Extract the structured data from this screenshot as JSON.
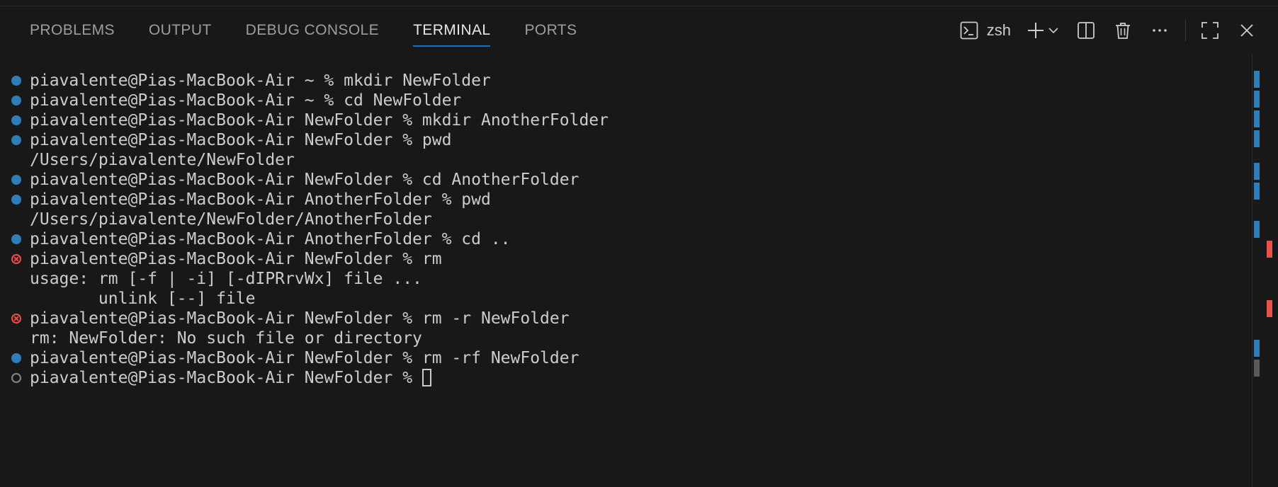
{
  "tabs": [
    {
      "label": "PROBLEMS",
      "active": false
    },
    {
      "label": "OUTPUT",
      "active": false
    },
    {
      "label": "DEBUG CONSOLE",
      "active": false
    },
    {
      "label": "TERMINAL",
      "active": true
    },
    {
      "label": "PORTS",
      "active": false
    }
  ],
  "toolbar": {
    "shell_label": "zsh",
    "icons": [
      "terminal-icon",
      "plus-icon",
      "chevron-down-icon",
      "split-icon",
      "trash-icon",
      "more-icon",
      "maximize-icon",
      "close-icon"
    ]
  },
  "terminal": {
    "lines": [
      {
        "status": "success",
        "text": "piavalente@Pias-MacBook-Air ~ % mkdir NewFolder"
      },
      {
        "status": "success",
        "text": "piavalente@Pias-MacBook-Air ~ % cd NewFolder"
      },
      {
        "status": "success",
        "text": "piavalente@Pias-MacBook-Air NewFolder % mkdir AnotherFolder"
      },
      {
        "status": "success",
        "text": "piavalente@Pias-MacBook-Air NewFolder % pwd"
      },
      {
        "status": "none",
        "text": "/Users/piavalente/NewFolder"
      },
      {
        "status": "success",
        "text": "piavalente@Pias-MacBook-Air NewFolder % cd AnotherFolder"
      },
      {
        "status": "success",
        "text": "piavalente@Pias-MacBook-Air AnotherFolder % pwd"
      },
      {
        "status": "none",
        "text": "/Users/piavalente/NewFolder/AnotherFolder"
      },
      {
        "status": "success",
        "text": "piavalente@Pias-MacBook-Air AnotherFolder % cd .."
      },
      {
        "status": "error",
        "text": "piavalente@Pias-MacBook-Air NewFolder % rm"
      },
      {
        "status": "none",
        "text": "usage: rm [-f | -i] [-dIPRrvWx] file ..."
      },
      {
        "status": "none",
        "text": "       unlink [--] file"
      },
      {
        "status": "error",
        "text": "piavalente@Pias-MacBook-Air NewFolder % rm -r NewFolder"
      },
      {
        "status": "none",
        "text": "rm: NewFolder: No such file or directory"
      },
      {
        "status": "success",
        "text": "piavalente@Pias-MacBook-Air NewFolder % rm -rf NewFolder"
      },
      {
        "status": "pending",
        "text": "piavalente@Pias-MacBook-Air NewFolder % "
      }
    ]
  },
  "colors": {
    "background": "#181818",
    "success": "#2f7eb8",
    "error": "#f14c4c",
    "accent": "#0078d4",
    "text": "#cccccc"
  }
}
